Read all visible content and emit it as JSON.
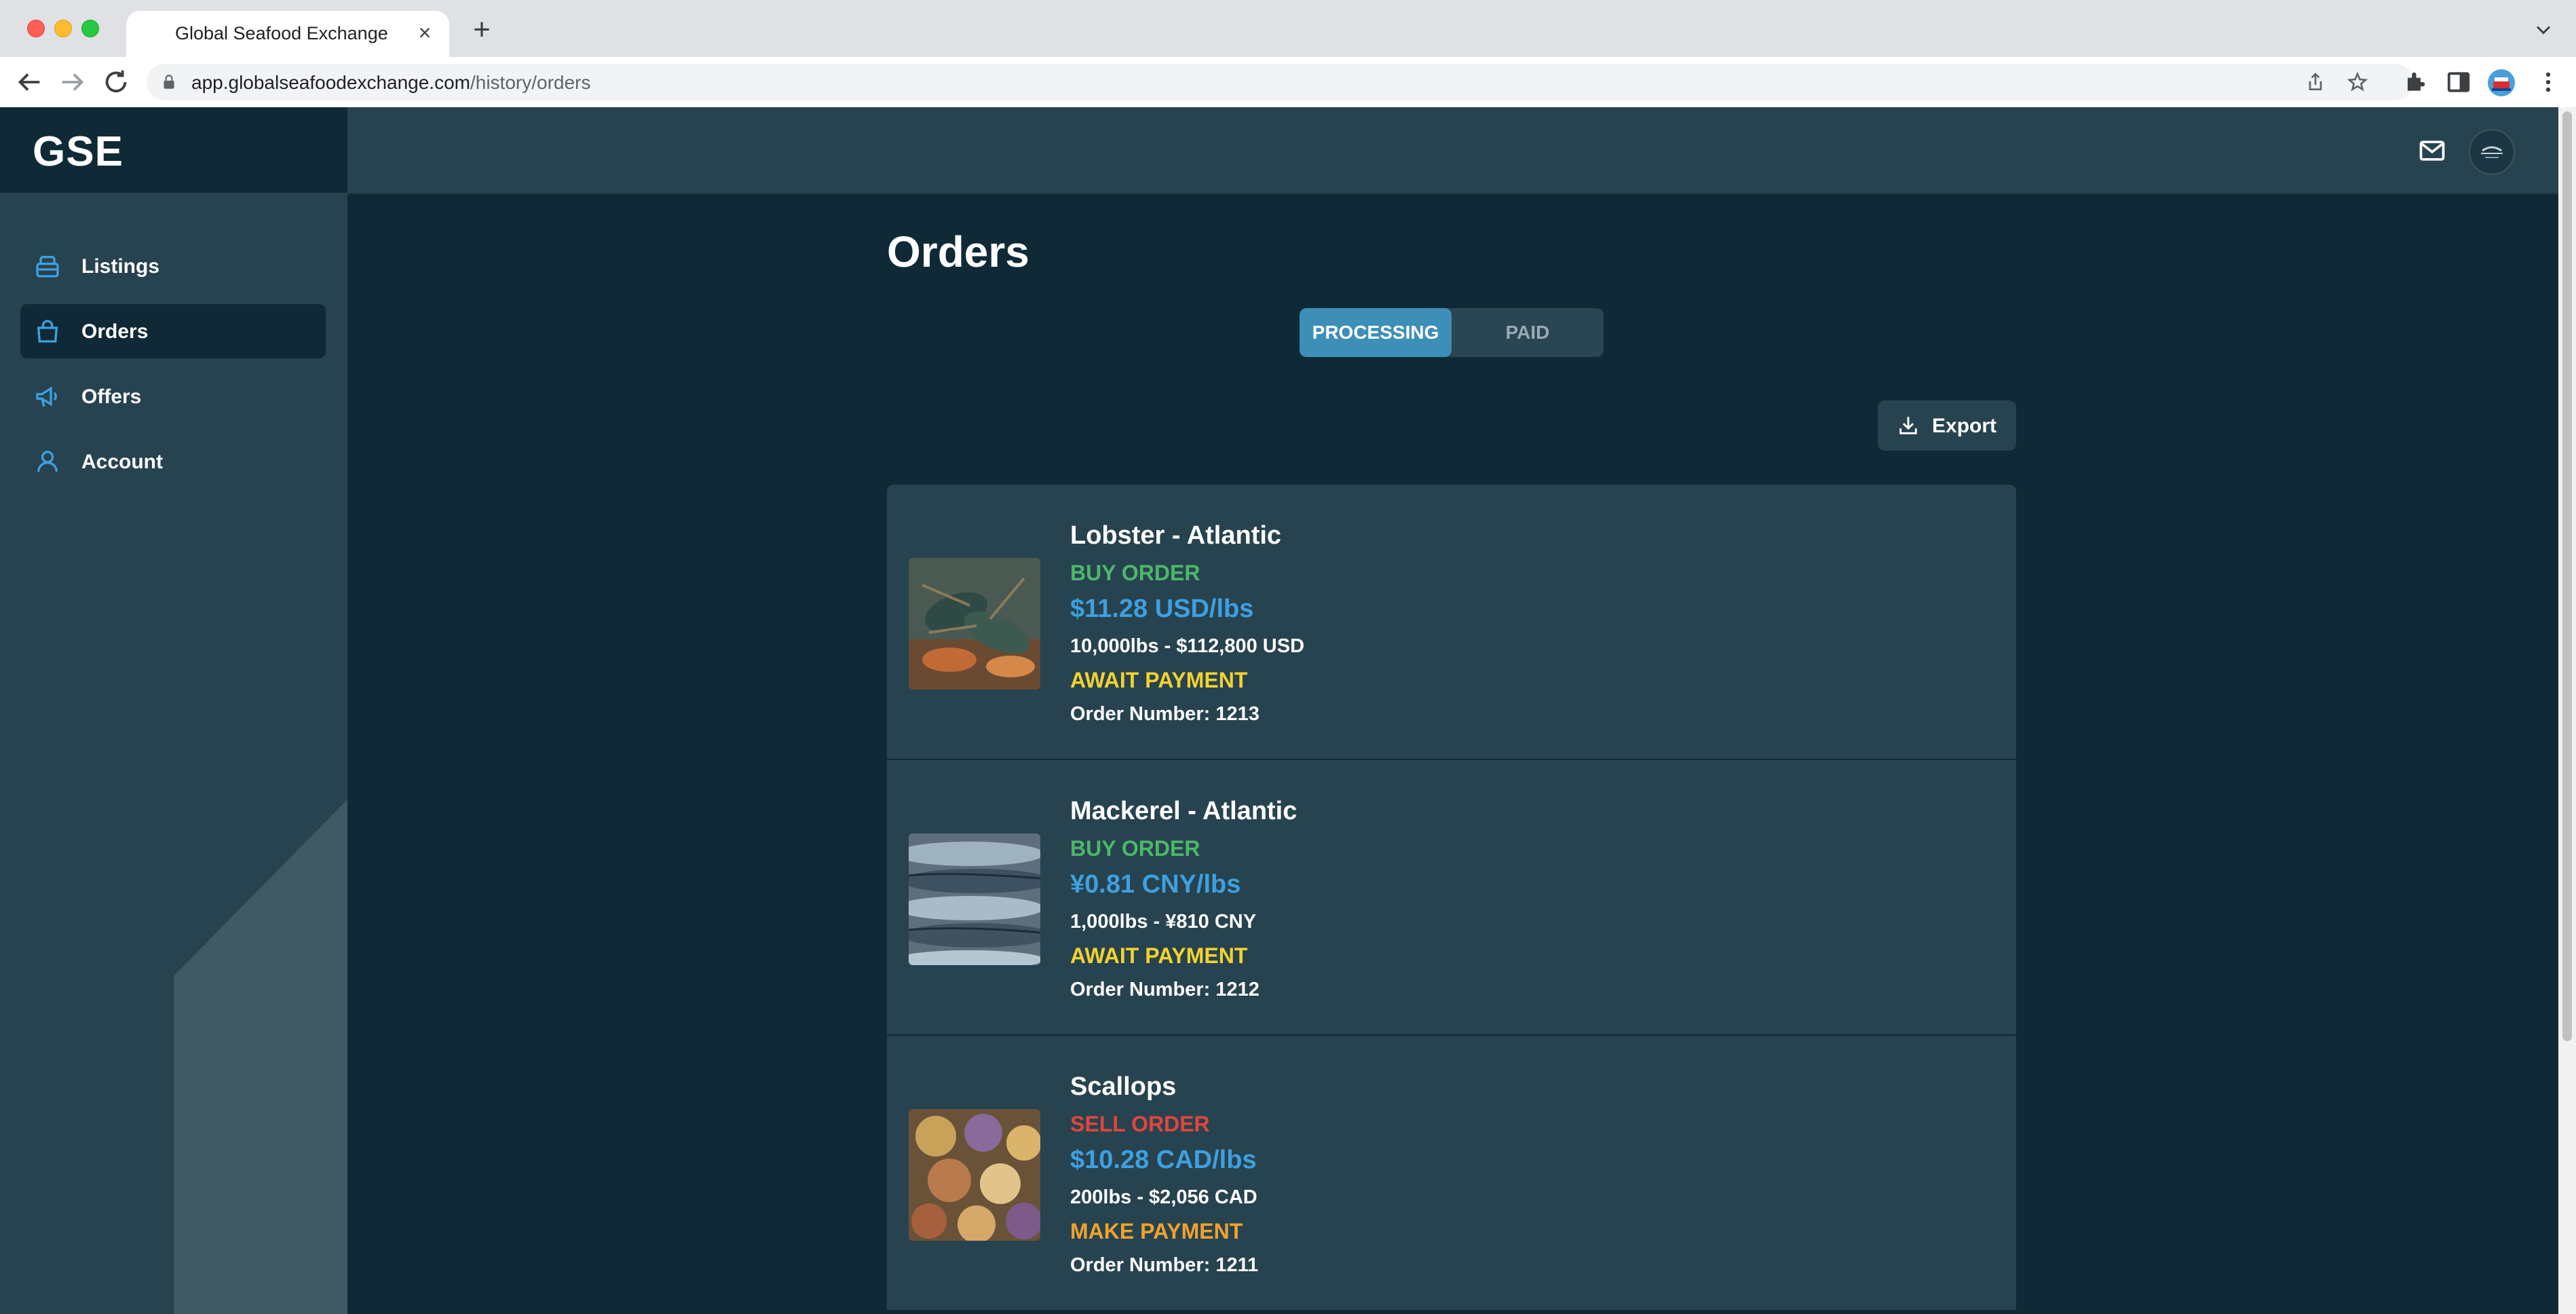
{
  "browser": {
    "tab_title": "Global Seafood Exchange",
    "tab_close": "×",
    "new_tab": "+",
    "url_host": "app.globalseafoodexchange.com",
    "url_path": "/history/orders"
  },
  "app": {
    "logo": "GSE",
    "sidebar": {
      "items": [
        {
          "label": "Listings",
          "icon": "basket-icon"
        },
        {
          "label": "Orders",
          "icon": "shopping-bag-icon",
          "active": true
        },
        {
          "label": "Offers",
          "icon": "megaphone-icon"
        },
        {
          "label": "Account",
          "icon": "user-icon"
        }
      ]
    },
    "topbar": {
      "icons": [
        "mail-icon",
        "avatar"
      ]
    }
  },
  "page": {
    "title": "Orders",
    "tabs": [
      {
        "label": "PROCESSING",
        "active": true
      },
      {
        "label": "PAID",
        "active": false
      }
    ],
    "export_label": "Export"
  },
  "orders": [
    {
      "name": "Lobster - Atlantic",
      "type": "BUY ORDER",
      "price": "$11.28 USD/lbs",
      "quantity": "10,000lbs - $112,800 USD",
      "status": "AWAIT PAYMENT",
      "order_number": "Order Number: 1213"
    },
    {
      "name": "Mackerel - Atlantic",
      "type": "BUY ORDER",
      "price": "¥0.81 CNY/lbs",
      "quantity": "1,000lbs - ¥810 CNY",
      "status": "AWAIT PAYMENT",
      "order_number": "Order Number: 1212"
    },
    {
      "name": "Scallops",
      "type": "SELL ORDER",
      "price": "$10.28 CAD/lbs",
      "quantity": "200lbs - $2,056 CAD",
      "status": "MAKE PAYMENT",
      "order_number": "Order Number: 1211"
    }
  ],
  "colors": {
    "buy": "#4cb86a",
    "sell": "#e0463e",
    "await_payment": "#f2d22e",
    "make_payment": "#f0a22e",
    "price": "#3ea0e0",
    "accent": "#3d8fb8",
    "bg": "#0f2a36",
    "panel": "#27434f"
  }
}
